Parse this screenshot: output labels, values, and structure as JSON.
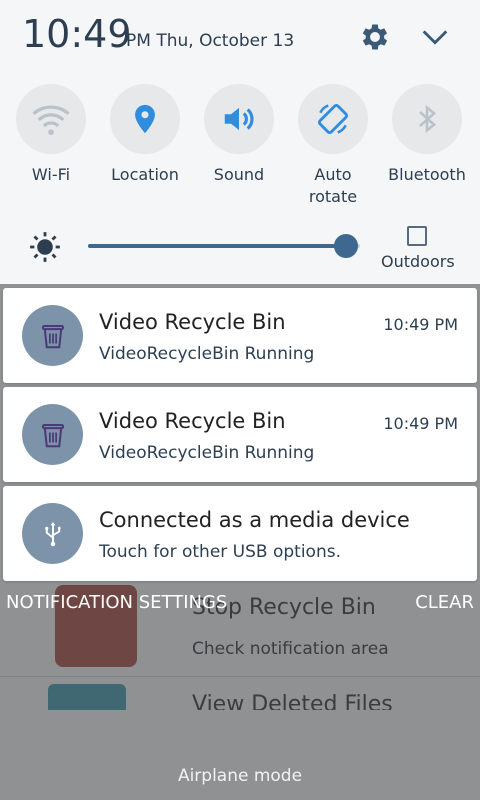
{
  "status": {
    "time": "10:49",
    "date": "PM Thu, October 13"
  },
  "quick_settings": {
    "tiles": [
      {
        "label": "Wi-Fi",
        "icon": "wifi-icon"
      },
      {
        "label": "Location",
        "icon": "location-pin-icon"
      },
      {
        "label": "Sound",
        "icon": "speaker-icon"
      },
      {
        "label": "Auto rotate",
        "icon": "auto-rotate-icon"
      },
      {
        "label": "Bluetooth",
        "icon": "bluetooth-icon"
      }
    ],
    "brightness_level": 0.95,
    "outdoors_label": "Outdoors",
    "outdoors_checked": false
  },
  "notifications": [
    {
      "title": "Video Recycle Bin",
      "subtitle": "VideoRecycleBin Running",
      "time": "10:49 PM",
      "icon": "trash-icon"
    },
    {
      "title": "Video Recycle Bin",
      "subtitle": "VideoRecycleBin Running",
      "time": "10:49 PM",
      "icon": "trash-icon"
    },
    {
      "title": "Connected as a media device",
      "subtitle": "Touch for other USB options.",
      "time": "",
      "icon": "usb-icon"
    }
  ],
  "actions": {
    "settings": "NOTIFICATION SETTINGS",
    "clear": "CLEAR"
  },
  "background_app": {
    "items": [
      {
        "title": "Stop Recycle Bin",
        "subtitle": "Check notification area"
      },
      {
        "title": "View Deleted Files",
        "subtitle": ""
      }
    ]
  },
  "footer": {
    "airplane": "Airplane mode"
  },
  "colors": {
    "panel_bg": "#f5f6f7",
    "accent": "#3f6890",
    "icon_blue": "#2f8ddf",
    "notif_icon_bg": "#7d93aa",
    "scrim": "#8f9193"
  }
}
